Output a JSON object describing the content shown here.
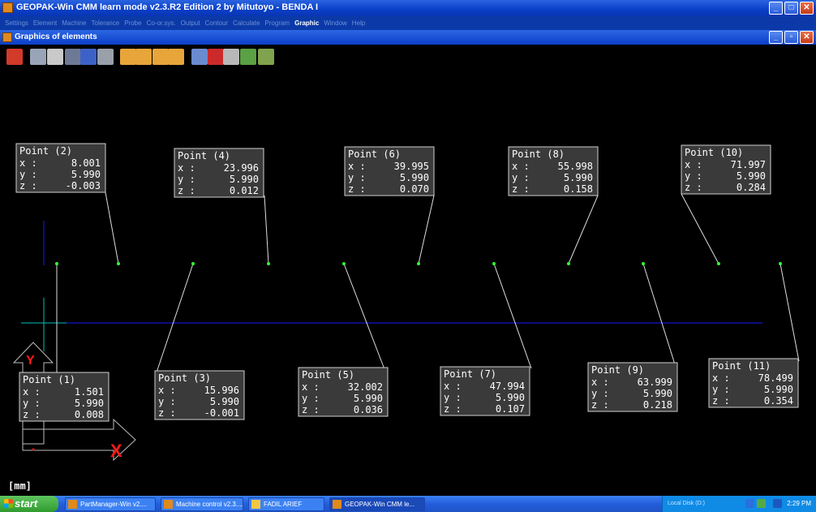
{
  "window": {
    "title": "GEOPAK-Win CMM learn mode v2.3.R2 Edition 2 by Mitutoyo - BENDA I",
    "controls": [
      "minimize",
      "maximize",
      "close"
    ]
  },
  "menu": {
    "items": [
      {
        "label": "Settings",
        "active": false
      },
      {
        "label": "Element",
        "active": false
      },
      {
        "label": "Machine",
        "active": false
      },
      {
        "label": "Tolerance",
        "active": false
      },
      {
        "label": "Probe",
        "active": false
      },
      {
        "label": "Co-or.sys.",
        "active": false
      },
      {
        "label": "Output",
        "active": false
      },
      {
        "label": "Contour",
        "active": false
      },
      {
        "label": "Calculate",
        "active": false
      },
      {
        "label": "Program",
        "active": false
      },
      {
        "label": "Graphic",
        "active": true
      },
      {
        "label": "Window",
        "active": false
      },
      {
        "label": "Help",
        "active": false
      }
    ]
  },
  "child_window": {
    "title": "Graphics of elements"
  },
  "toolbar": {
    "icons": [
      "delete-icon",
      "zoom-icon",
      "pan-hand-icon",
      "measure-icon",
      "probe-icon",
      "target-icon",
      "view-xy-icon",
      "view-xz-icon",
      "view-yz-icon",
      "view-3d-icon",
      "color-icon",
      "point-icon",
      "rotate-icon",
      "element-icon",
      "scenery-icon"
    ]
  },
  "graphic": {
    "axis_labels": {
      "y": "Y",
      "x": "X"
    },
    "coord_labels": {
      "x": "x :",
      "y": "y :",
      "z": "z :"
    },
    "points": [
      {
        "name": "Point (1)",
        "x": "1.501",
        "y": "5.990",
        "z": "0.008"
      },
      {
        "name": "Point (2)",
        "x": "8.001",
        "y": "5.990",
        "z": "-0.003"
      },
      {
        "name": "Point (3)",
        "x": "15.996",
        "y": "5.990",
        "z": "-0.001"
      },
      {
        "name": "Point (4)",
        "x": "23.996",
        "y": "5.990",
        "z": "0.012"
      },
      {
        "name": "Point (5)",
        "x": "32.002",
        "y": "5.990",
        "z": "0.036"
      },
      {
        "name": "Point (6)",
        "x": "39.995",
        "y": "5.990",
        "z": "0.070"
      },
      {
        "name": "Point (7)",
        "x": "47.994",
        "y": "5.990",
        "z": "0.107"
      },
      {
        "name": "Point (8)",
        "x": "55.998",
        "y": "5.990",
        "z": "0.158"
      },
      {
        "name": "Point (9)",
        "x": "63.999",
        "y": "5.990",
        "z": "0.218"
      },
      {
        "name": "Point (10)",
        "x": "71.997",
        "y": "5.990",
        "z": "0.284"
      },
      {
        "name": "Point (11)",
        "x": "78.499",
        "y": "5.990",
        "z": "0.354"
      }
    ],
    "units": "[mm]"
  },
  "taskbar": {
    "start_label": "start",
    "tasks": [
      {
        "label": "PartManager-Win v2....",
        "active": false
      },
      {
        "label": "Machine control v2.3....",
        "active": false
      },
      {
        "label": "FADIL ARIEF",
        "active": false
      },
      {
        "label": "GEOPAK-Win CMM le...",
        "active": true
      }
    ],
    "tray": {
      "disk": "Local Disk (D:)",
      "time": "2:29 PM"
    }
  },
  "colors": {
    "background": "#000000",
    "point_marker": "#33ff33",
    "axis_blue": "#0000ff",
    "axis_cyan": "#00c0c0",
    "label_bg": "#3a3a3a",
    "x_marker": "#ff1a1a"
  }
}
